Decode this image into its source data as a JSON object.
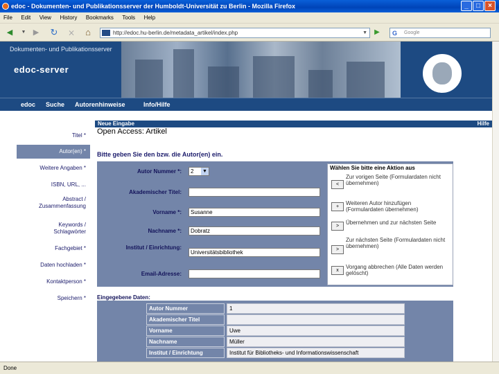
{
  "window": {
    "title": "edoc - Dokumenten- und Publikationsserver der Humboldt-Universität zu Berlin - Mozilla Firefox",
    "minimize": "_",
    "maximize": "□",
    "close": "×"
  },
  "menu": [
    "File",
    "Edit",
    "View",
    "History",
    "Bookmarks",
    "Tools",
    "Help"
  ],
  "navbar": {
    "url": "http://edoc.hu-berlin.de/metadata_artikel/index.php",
    "search_placeholder": "Google",
    "search_engine_glyph": "G"
  },
  "site": {
    "name": "Dokumenten- und Publikationsserver",
    "server": "edoc-server"
  },
  "topnav": [
    "edoc",
    "Suche",
    "Autorenhinweise",
    "Info/Hilfe"
  ],
  "leftnav": [
    {
      "label": "Titel *"
    },
    {
      "label": "Autor(en) *",
      "active": true
    },
    {
      "label": "Weitere Angaben *"
    },
    {
      "label": "ISBN, URL, ..."
    },
    {
      "label": "Abstract / Zusammenfassung"
    },
    {
      "label": "Keywords / Schlagwörter"
    },
    {
      "label": "Fachgebiet *"
    },
    {
      "label": "Daten hochladen *"
    },
    {
      "label": "Kontaktperson *"
    },
    {
      "label": "Speichern *"
    }
  ],
  "content": {
    "bar_left": "Neue Eingabe",
    "bar_right": "Hilfe",
    "title": "Open Access: Artikel",
    "instructions": "Bitte geben Sie den bzw. die Autor(en) ein."
  },
  "form": {
    "author_number_label": "Autor Nummer *:",
    "author_number_value": "2",
    "academic_title_label": "Akademischer Titel:",
    "academic_title_value": "",
    "firstname_label": "Vorname *:",
    "firstname_value": "Susanne",
    "lastname_label": "Nachname *:",
    "lastname_value": "Dobratz",
    "institute_label": "Institut / Einrichtung:",
    "institute_value": "Universitätsbibliothek",
    "email_label": "Email-Adresse:",
    "email_value": ""
  },
  "actions": {
    "heading": "Wählen Sie bitte eine Aktion aus",
    "items": [
      {
        "button": "<",
        "text": "Zur vorigen Seite (Formulardaten nicht übernehmen)"
      },
      {
        "button": "+",
        "text": "Weiteren Autor hinzufügen (Formulardaten übernehmen)"
      },
      {
        "button": ">",
        "text": "Übernehmen und zur nächsten Seite"
      },
      {
        "button": ">",
        "text": "Zur nächsten Seite (Formulardaten nicht übernehmen)"
      },
      {
        "button": "x",
        "text": "Vorgang abbrechen (Alle Daten werden gelöscht)"
      }
    ]
  },
  "entered": {
    "label": "Eingegebene Daten:",
    "rows": [
      {
        "key": "Autor Nummer",
        "value": "1"
      },
      {
        "key": "Akademischer Titel",
        "value": ""
      },
      {
        "key": "Vorname",
        "value": "Uwe"
      },
      {
        "key": "Nachname",
        "value": "Müller"
      },
      {
        "key": "Institut / Einrichtung",
        "value": "Institut für Bibliotheks- und Informationswissenschaft"
      }
    ]
  },
  "status": "Done",
  "colors": {
    "brand_blue": "#1d4a82",
    "panel_blue": "#7385a9"
  }
}
